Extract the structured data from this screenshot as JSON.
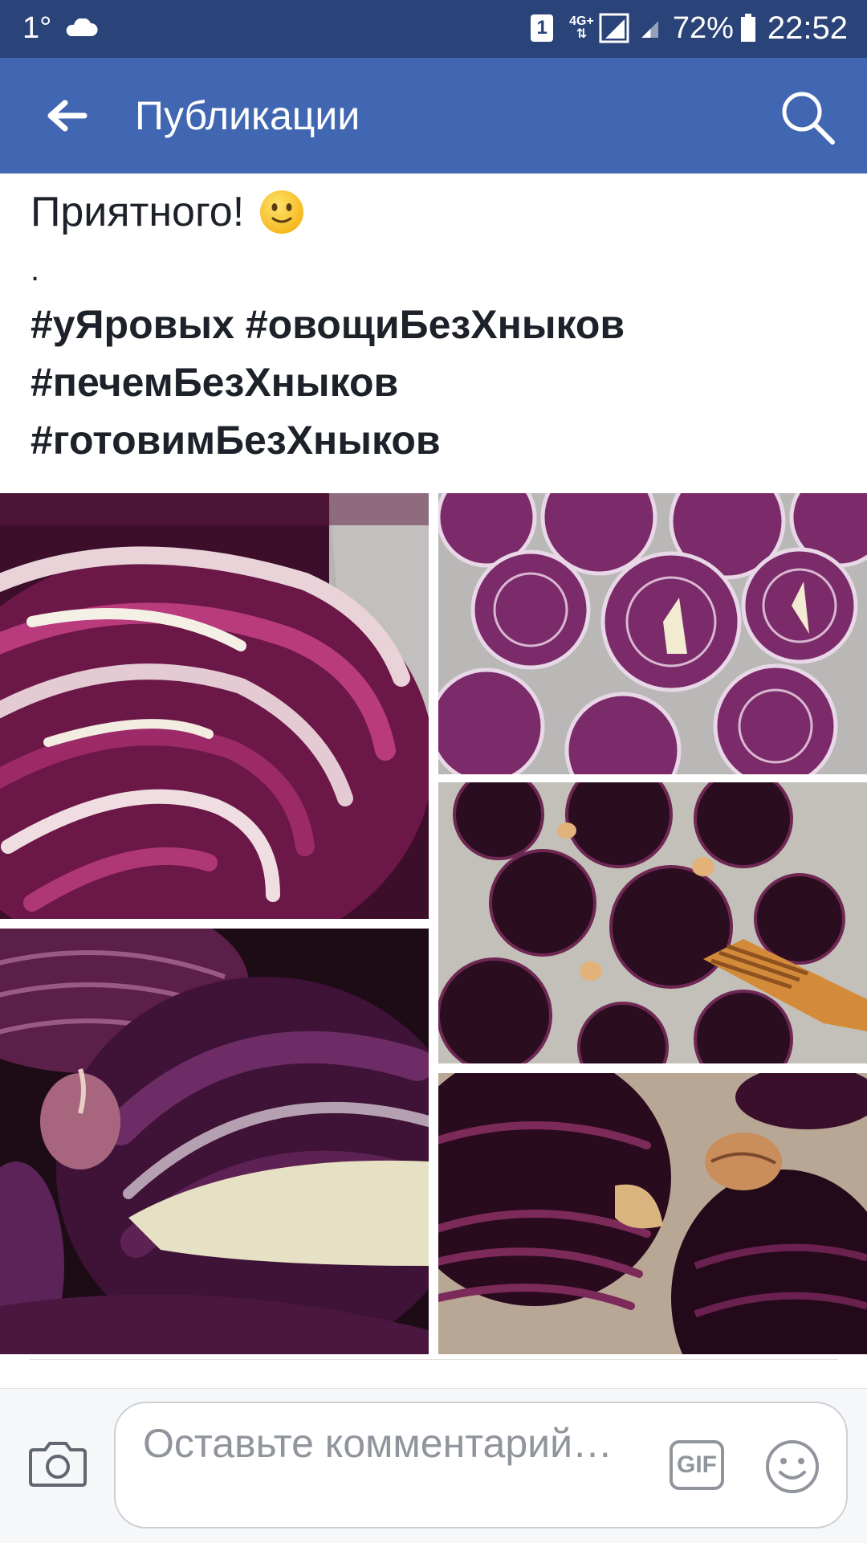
{
  "status_bar": {
    "temperature": "1°",
    "weather_icon": "cloud-icon",
    "sim_badge": "1",
    "network_type": "4G+",
    "battery_percent": "72%",
    "time": "22:52"
  },
  "app_bar": {
    "title": "Публикации",
    "back_icon": "arrow-left-icon",
    "search_icon": "search-icon",
    "background_color": "#4267b2"
  },
  "post": {
    "text_line": "Приятного!",
    "emoji": "slightly-smiling-face-emoji",
    "separator_dot": ".",
    "hashtags": [
      "#уЯровых #овощиБезХныков",
      "#печемБезХныков",
      "#готовимБезХныков"
    ],
    "photos": [
      {
        "name": "red-cabbage-closeup-photo"
      },
      {
        "name": "red-cabbage-slices-on-foil-photo"
      },
      {
        "name": "roasted-cabbage-with-spatula-photo"
      },
      {
        "name": "cabbage-with-garlic-photo"
      },
      {
        "name": "roasted-cabbage-closeup-photo"
      }
    ]
  },
  "comment_bar": {
    "placeholder": "Оставьте комментарий…",
    "gif_label": "GIF",
    "camera_icon": "camera-icon",
    "emoji_icon": "smiley-icon"
  }
}
